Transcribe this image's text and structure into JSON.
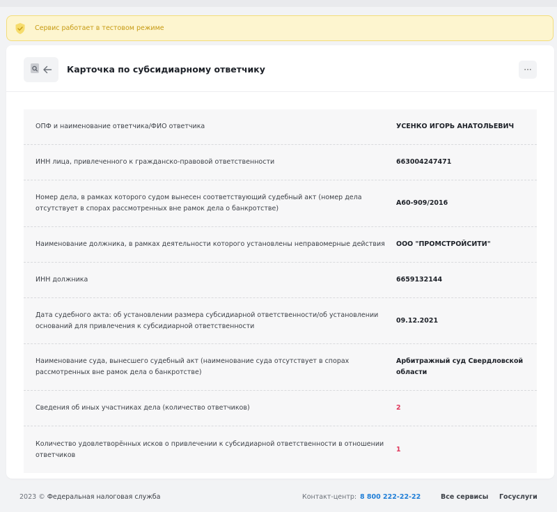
{
  "banner": {
    "text": "Сервис работает в тестовом режиме",
    "icon": "shield-check-icon",
    "color": "#c69a12"
  },
  "card": {
    "title": "Карточка по субсидиарному ответчику",
    "more_label": "···"
  },
  "rows": [
    {
      "label": "ОПФ и наименование ответчика/ФИО ответчика",
      "value": "УСЕНКО ИГОРЬ АНАТОЛЬЕВИЧ"
    },
    {
      "label": "ИНН лица, привлеченного к гражданско-правовой ответственности",
      "value": "663004247471"
    },
    {
      "label": "Номер дела, в рамках которого судом вынесен соответствующий судебный акт (номер дела отсутствует в спорах рассмотренных вне рамок дела о банкротстве)",
      "value": "А60-909/2016"
    },
    {
      "label": "Наименование должника, в рамках деятельности которого установлены неправомерные действия",
      "value": "ООО \"ПРОМСТРОЙСИТИ\""
    },
    {
      "label": "ИНН должника",
      "value": "6659132144"
    },
    {
      "label": "Дата судебного акта: об установлении размера субсидиарной ответственности/об установлении оснований для привлечения к субсидиарной ответственности",
      "value": "09.12.2021"
    },
    {
      "label": "Наименование суда, вынесшего судебный акт (наименование суда отсутствует в спорах рассмотренных вне рамок дела о банкротстве)",
      "value": "Арбитражный суд Свердловской области"
    },
    {
      "label": "Сведения об иных участниках дела (количество ответчиков)",
      "value": "2"
    },
    {
      "label": "Количество удовлетворённых исков о привлечении к субсидиарной ответственности в отношении ответчиков",
      "value": "1"
    }
  ],
  "footer": {
    "year": "2023 ©",
    "org": "Федеральная налоговая служба",
    "contact_label": "Контакт-центр:",
    "phone": "8 800 222-22-22",
    "link_services": "Все сервисы",
    "link_gosuslugi": "Госуслуги"
  },
  "colors": {
    "accent_link": "#1f7ed7",
    "count_value": "#e0365a",
    "banner_bg": "#fdf5cf"
  }
}
